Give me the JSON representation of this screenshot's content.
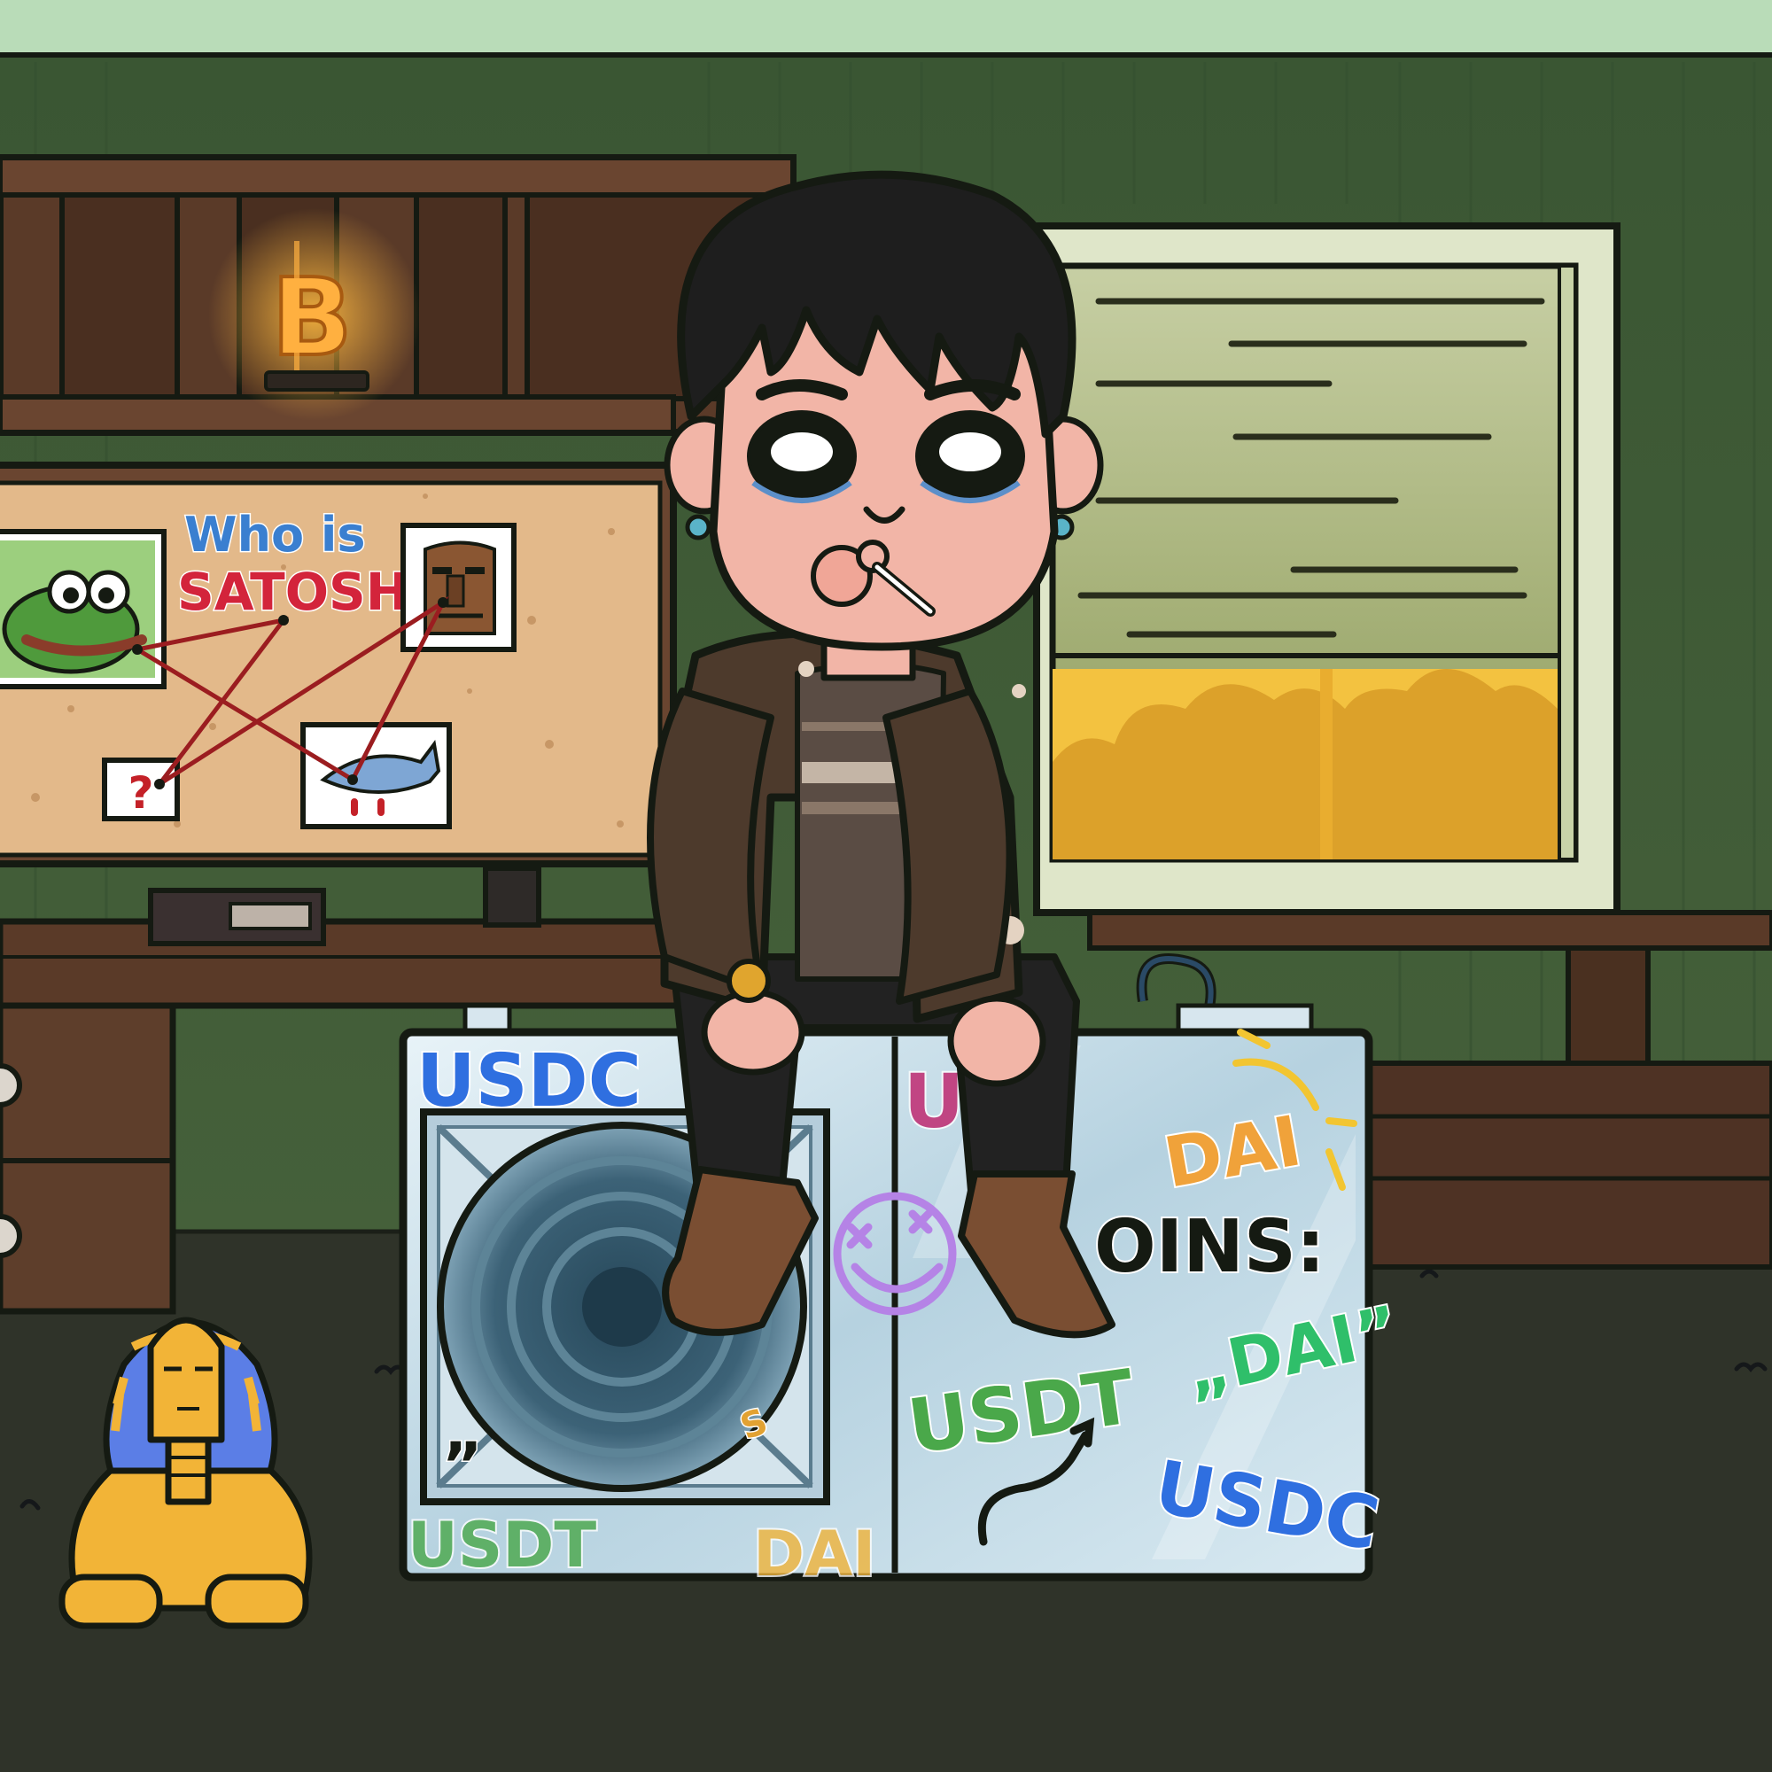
{
  "scene": {
    "colors": {
      "ceiling": "#b9dcb8",
      "wall": "#3f5a36",
      "floor": "#2f3329",
      "wood": "#5a3a28",
      "cork": "#e3b98a",
      "string": "#9b1d20",
      "sunset": "#f3c240",
      "glass": "#cfe4ee",
      "jacket": "#4d3a2c",
      "sphinx": "#f2b437"
    },
    "shelf": {
      "lamp_glyph": "B",
      "lamp_icon": "bitcoin-neon-icon"
    },
    "corkboard": {
      "title_line1": "Who is",
      "title_line2": "SATOSHi",
      "question_mark": "?"
    },
    "miner": {
      "stickers": {
        "usdc_top": "USDC",
        "us_partial": "US",
        "dai_top": "DAI",
        "coins_partial": "OINS:",
        "dai_quote": "„DAI”",
        "usdt_right": "USDT",
        "usdc_bottom": "USDC",
        "usdt_bottom": "USDT",
        "dai_bottom": "DAI",
        "quote_left": "„",
        "s_small": "S"
      }
    }
  }
}
